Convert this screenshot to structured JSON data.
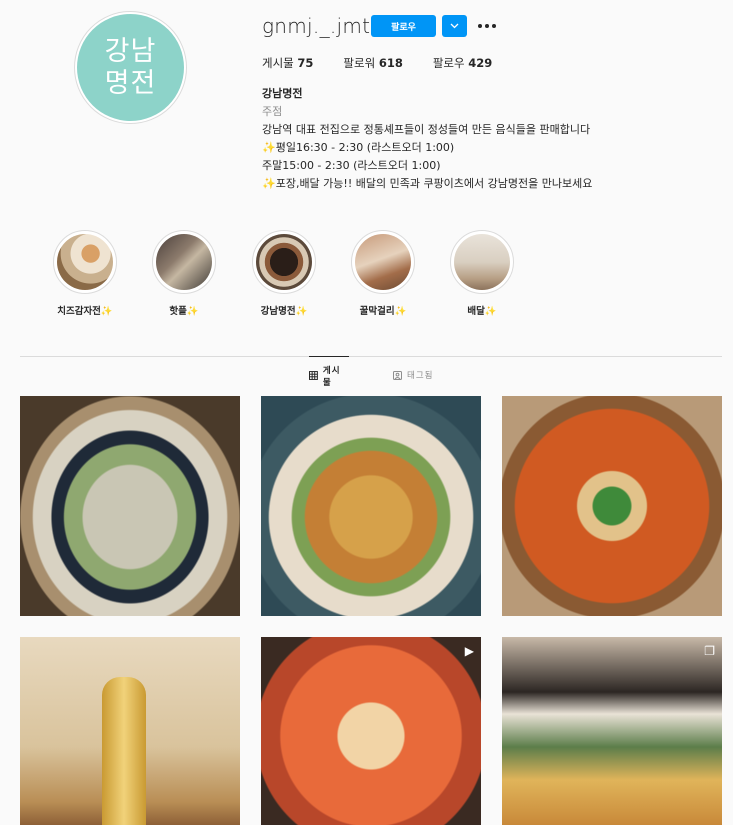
{
  "profile": {
    "username": "gnmj._.jmt",
    "avatar_text_top": "강남",
    "avatar_text_bottom": "명전",
    "follow_label": "팔로우",
    "stats": {
      "posts_label": "게시물",
      "posts_value": "75",
      "followers_label": "팔로워",
      "followers_value": "618",
      "following_label": "팔로우",
      "following_value": "429"
    },
    "bio": {
      "name": "강남명전",
      "category": "주점",
      "line1": "강남역 대표 전집으로 정통셰프들이 정성들여 만든 음식들을 판매합니다",
      "line2_sparkle": "✨",
      "line2": "평일16:30 - 2:30 (라스트오더 1:00)",
      "line3": "주말15:00 - 2:30 (라스트오더 1:00)",
      "line4_sparkle": "✨",
      "line4": "포장,배달 가능!! 배달의 민족과 쿠팡이츠에서 강남명전을 만나보세요"
    }
  },
  "highlights": [
    {
      "label": "치즈감자전",
      "sparkle": "✨"
    },
    {
      "label": "핫플",
      "sparkle": "✨"
    },
    {
      "label": "강남명전",
      "sparkle": "✨"
    },
    {
      "label": "꿀막걸리",
      "sparkle": "✨"
    },
    {
      "label": "배달",
      "sparkle": "✨"
    }
  ],
  "tabs": {
    "posts": "게시물",
    "tagged": "태그됨"
  },
  "colors": {
    "accent": "#0095f6",
    "avatar_bg": "#8dd3c9",
    "sparkle": "#f7c93b"
  },
  "icons": {
    "suggest": "chevron-down-icon",
    "more": "more-horizontal-icon",
    "grid": "grid-icon",
    "tagged": "tagged-icon",
    "reel": "reel-play-icon",
    "carousel": "carousel-icon"
  }
}
